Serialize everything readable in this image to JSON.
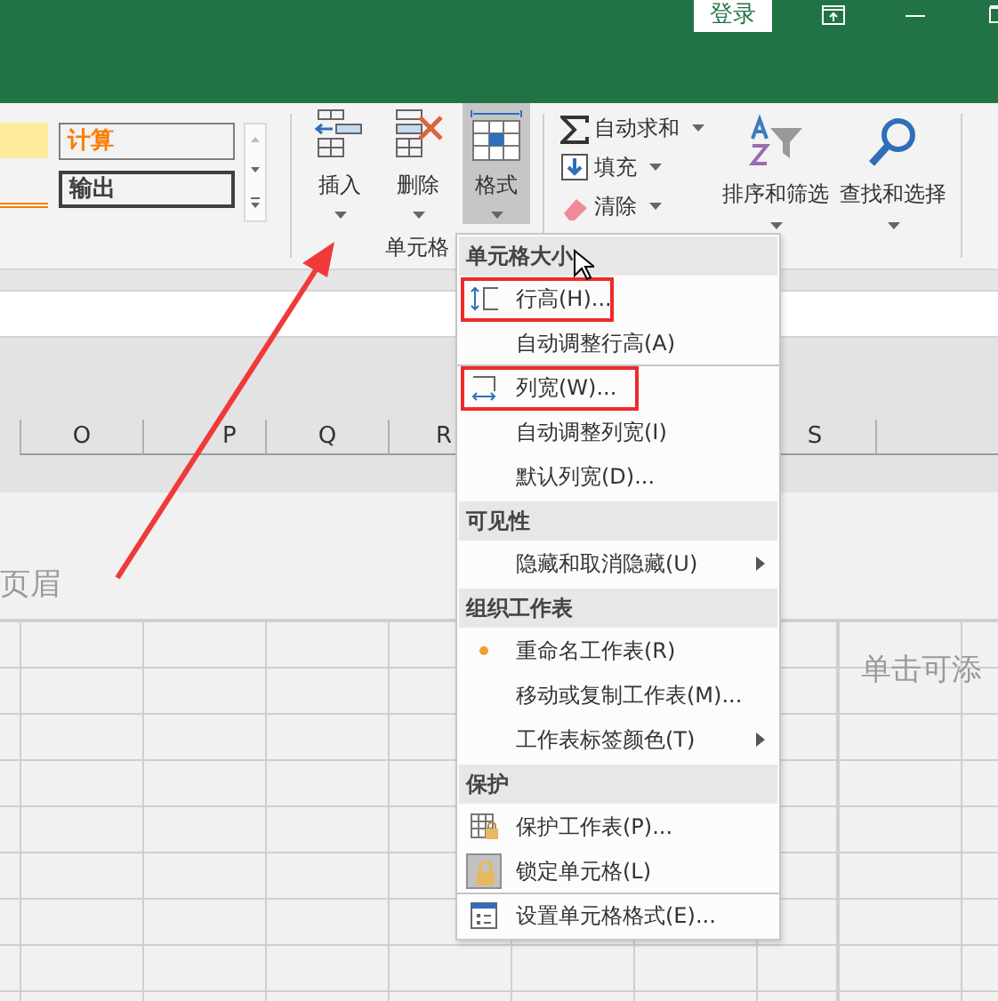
{
  "title_bar": {
    "login": "登录"
  },
  "styles_gallery": {
    "cells": [
      {
        "label": "计算",
        "kind": "calc"
      },
      {
        "label": "输出",
        "kind": "output"
      }
    ]
  },
  "cells_group": {
    "label": "单元格",
    "buttons": [
      {
        "label": "插入",
        "kind": "insert",
        "selected": false
      },
      {
        "label": "删除",
        "kind": "delete",
        "selected": false
      },
      {
        "label": "格式",
        "kind": "format",
        "selected": true
      }
    ]
  },
  "editing_group": {
    "small_buttons": [
      {
        "label": "自动求和",
        "kind": "sum"
      },
      {
        "label": "填充",
        "kind": "fill"
      },
      {
        "label": "清除",
        "kind": "clear"
      }
    ],
    "big_buttons": [
      {
        "label": "排序和筛选",
        "kind": "sort"
      },
      {
        "label": "查找和选择",
        "kind": "find"
      }
    ]
  },
  "left_page": {
    "columns": [
      "O",
      "P",
      "Q",
      "R"
    ],
    "header_text": "页眉"
  },
  "right_page": {
    "columns": [
      "S"
    ],
    "header_text": "单击可添"
  },
  "format_menu": {
    "sections": [
      {
        "title": "单元格大小",
        "items": [
          {
            "label": "行高(H)...",
            "kind": "rowheight",
            "highlighted": true,
            "checked": false,
            "submenu": false,
            "divider_below": false
          },
          {
            "label": "自动调整行高(A)",
            "kind": "plain",
            "highlighted": false,
            "checked": false,
            "submenu": false,
            "divider_below": true
          },
          {
            "label": "列宽(W)...",
            "kind": "colwidth",
            "highlighted": true,
            "checked": false,
            "submenu": false,
            "divider_below": false
          },
          {
            "label": "自动调整列宽(I)",
            "kind": "plain",
            "highlighted": false,
            "checked": false,
            "submenu": false,
            "divider_below": false
          },
          {
            "label": "默认列宽(D)...",
            "kind": "plain",
            "highlighted": false,
            "checked": false,
            "submenu": false,
            "divider_below": false
          }
        ]
      },
      {
        "title": "可见性",
        "items": [
          {
            "label": "隐藏和取消隐藏(U)",
            "kind": "plain",
            "highlighted": false,
            "checked": false,
            "submenu": true,
            "divider_below": false
          }
        ]
      },
      {
        "title": "组织工作表",
        "items": [
          {
            "label": "重命名工作表(R)",
            "kind": "dot",
            "highlighted": false,
            "checked": false,
            "submenu": false,
            "divider_below": false
          },
          {
            "label": "移动或复制工作表(M)...",
            "kind": "plain",
            "highlighted": false,
            "checked": false,
            "submenu": false,
            "divider_below": false
          },
          {
            "label": "工作表标签颜色(T)",
            "kind": "plain",
            "highlighted": false,
            "checked": false,
            "submenu": true,
            "divider_below": false
          }
        ]
      },
      {
        "title": "保护",
        "items": [
          {
            "label": "保护工作表(P)...",
            "kind": "protect",
            "highlighted": false,
            "checked": false,
            "submenu": false,
            "divider_below": false
          },
          {
            "label": "锁定单元格(L)",
            "kind": "lock",
            "highlighted": false,
            "checked": true,
            "submenu": false,
            "divider_below": true
          },
          {
            "label": "设置单元格格式(E)...",
            "kind": "format",
            "highlighted": false,
            "checked": false,
            "submenu": false,
            "divider_below": false
          }
        ]
      }
    ]
  },
  "annotation_arrow": true
}
